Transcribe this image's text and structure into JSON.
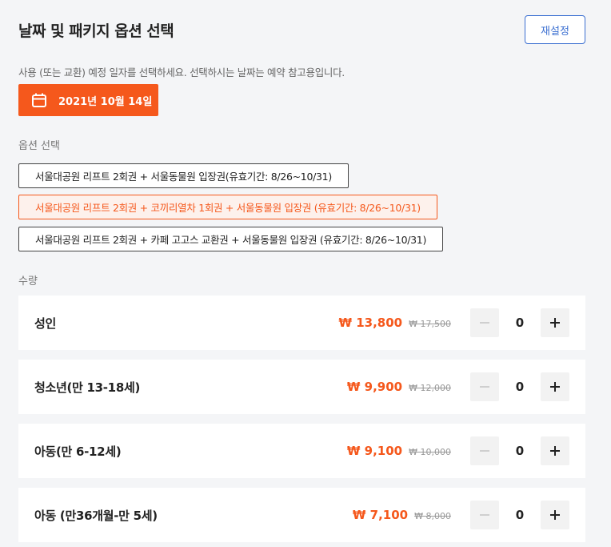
{
  "header": {
    "title": "날짜 및 패키지 옵션 선택",
    "reset_label": "재설정"
  },
  "date": {
    "description": "사용 (또는 교환) 예정 일자를 선택하세요. 선택하시는 날짜는 예약 참고용입니다.",
    "selected_date": "2021년 10월 14일",
    "icon": "calendar-icon"
  },
  "options": {
    "label": "옵션 선택",
    "items": [
      {
        "label": "서울대공원 리프트 2회권 + 서울동물원 입장권(유효기간: 8/26~10/31)",
        "selected": false
      },
      {
        "label": "서울대공원 리프트 2회권 + 코끼리열차 1회권 + 서울동물원 입장권 (유효기간: 8/26~10/31)",
        "selected": true
      },
      {
        "label": "서울대공원 리프트 2회권 + 카페 고고스 교환권 + 서울동물원 입장권 (유효기간: 8/26~10/31)",
        "selected": false
      }
    ]
  },
  "quantity": {
    "label": "수량",
    "rows": [
      {
        "name": "성인",
        "price": "₩ 13,800",
        "original": "₩ 17,500",
        "count": "0"
      },
      {
        "name": "청소년(만 13-18세)",
        "price": "₩ 9,900",
        "original": "₩ 12,000",
        "count": "0"
      },
      {
        "name": "아동(만 6-12세)",
        "price": "₩ 9,100",
        "original": "₩ 10,000",
        "count": "0"
      },
      {
        "name": "아동 (만36개월-만 5세)",
        "price": "₩ 7,100",
        "original": "₩ 8,000",
        "count": "0"
      }
    ]
  },
  "colors": {
    "accent": "#f5581c",
    "link": "#3b6fd1"
  }
}
